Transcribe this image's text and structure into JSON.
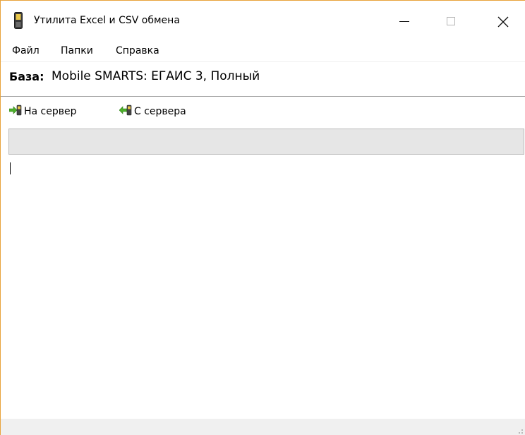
{
  "window": {
    "title": "Утилита Excel и CSV обмена",
    "icons": {
      "app": "mobile-device-icon",
      "minimize": "minimize-icon",
      "maximize": "maximize-icon",
      "close": "close-icon"
    }
  },
  "menu": {
    "items": [
      "Файл",
      "Папки",
      "Справка"
    ]
  },
  "database": {
    "label": "База:",
    "value": "Mobile SMARTS: ЕГАИС 3, Полный"
  },
  "toolbar": {
    "upload_label": "На сервер",
    "upload_icon": "arrow-right-device-icon",
    "download_label": "С сервера",
    "download_icon": "arrow-left-device-icon"
  },
  "progress": {
    "value": 0
  },
  "log": {
    "text": ""
  },
  "colors": {
    "window_border": "#e8a33b",
    "progress_track": "#e6e6e6",
    "statusbar": "#f0f0f0",
    "arrow_green": "#4caf2a"
  }
}
